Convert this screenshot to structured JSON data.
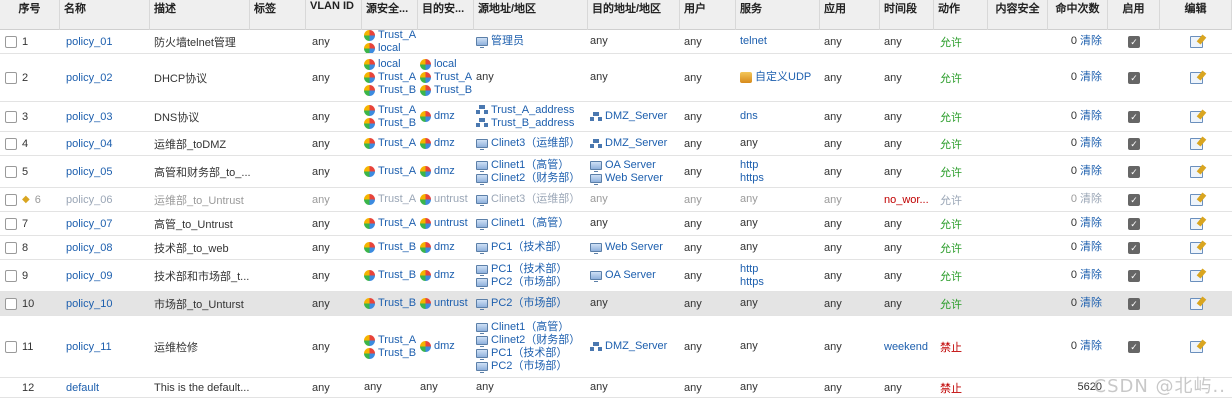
{
  "columns": [
    "序号",
    "名称",
    "描述",
    "标签",
    "VLAN ID",
    "源安全...",
    "目的安...",
    "源地址/地区",
    "目的地址/地区",
    "用户",
    "服务",
    "应用",
    "时间段",
    "动作",
    "内容安全",
    "命中次数",
    "启用",
    "编辑"
  ],
  "rows": [
    {
      "seq": "1",
      "name": "policy_01",
      "desc": "防火墙telnet管理",
      "vlan": "any",
      "src_zone": [
        {
          "t": "Trust_A",
          "z": 1
        },
        {
          "t": "local",
          "z": 1
        }
      ],
      "dst_zone": [],
      "src_addr": [
        {
          "t": "管理员",
          "i": "mon"
        }
      ],
      "dst_addr": [
        {
          "t": "any"
        }
      ],
      "user": "any",
      "service": [
        {
          "t": "telnet",
          "l": 1
        }
      ],
      "app": "any",
      "time": "any",
      "action": "允许",
      "hits": "0",
      "clear": "清除"
    },
    {
      "seq": "2",
      "name": "policy_02",
      "desc": "DHCP协议",
      "vlan": "any",
      "src_zone": [
        {
          "t": "local",
          "z": 1
        },
        {
          "t": "Trust_A",
          "z": 1
        },
        {
          "t": "Trust_B",
          "z": 1
        }
      ],
      "dst_zone": [
        {
          "t": "local",
          "z": 1
        },
        {
          "t": "Trust_A",
          "z": 1
        },
        {
          "t": "Trust_B",
          "z": 1
        }
      ],
      "src_addr": [
        {
          "t": "any"
        }
      ],
      "dst_addr": [
        {
          "t": "any"
        }
      ],
      "user": "any",
      "service": [
        {
          "t": "自定义UDP",
          "i": "udp"
        }
      ],
      "app": "any",
      "time": "any",
      "action": "允许",
      "hits": "0",
      "clear": "清除"
    },
    {
      "seq": "3",
      "name": "policy_03",
      "desc": "DNS协议",
      "vlan": "any",
      "src_zone": [
        {
          "t": "Trust_A",
          "z": 1
        },
        {
          "t": "Trust_B",
          "z": 1
        }
      ],
      "dst_zone": [
        {
          "t": "dmz",
          "z": 1
        }
      ],
      "src_addr": [
        {
          "t": "Trust_A_address",
          "i": "srv"
        },
        {
          "t": "Trust_B_address",
          "i": "srv"
        }
      ],
      "dst_addr": [
        {
          "t": "DMZ_Server",
          "i": "srv"
        }
      ],
      "user": "any",
      "service": [
        {
          "t": "dns",
          "l": 1
        }
      ],
      "app": "any",
      "time": "any",
      "action": "允许",
      "hits": "0",
      "clear": "清除"
    },
    {
      "seq": "4",
      "name": "policy_04",
      "desc": "运维部_toDMZ",
      "vlan": "any",
      "src_zone": [
        {
          "t": "Trust_A",
          "z": 1
        }
      ],
      "dst_zone": [
        {
          "t": "dmz",
          "z": 1
        }
      ],
      "src_addr": [
        {
          "t": "Clinet3（运维部）",
          "i": "mon"
        }
      ],
      "dst_addr": [
        {
          "t": "DMZ_Server",
          "i": "srv"
        }
      ],
      "user": "any",
      "service": [
        {
          "t": "any"
        }
      ],
      "app": "any",
      "time": "any",
      "action": "允许",
      "hits": "0",
      "clear": "清除"
    },
    {
      "seq": "5",
      "name": "policy_05",
      "desc": "高管和财务部_to_...",
      "vlan": "any",
      "src_zone": [
        {
          "t": "Trust_A",
          "z": 1
        }
      ],
      "dst_zone": [
        {
          "t": "dmz",
          "z": 1
        }
      ],
      "src_addr": [
        {
          "t": "Clinet1（高管）",
          "i": "mon"
        },
        {
          "t": "Clinet2（财务部）",
          "i": "mon"
        }
      ],
      "dst_addr": [
        {
          "t": "OA Server",
          "i": "mon"
        },
        {
          "t": "Web Server",
          "i": "mon"
        }
      ],
      "user": "any",
      "service": [
        {
          "t": "http",
          "l": 1
        },
        {
          "t": "https",
          "l": 1
        }
      ],
      "app": "any",
      "time": "any",
      "action": "允许",
      "hits": "0",
      "clear": "清除"
    },
    {
      "seq": "6",
      "name": "policy_06",
      "desc": "运维部_to_Untrust",
      "vlan": "any",
      "src_zone": [
        {
          "t": "Trust_A",
          "z": 1
        }
      ],
      "dst_zone": [
        {
          "t": "untrust",
          "z": 1
        }
      ],
      "src_addr": [
        {
          "t": "Clinet3（运维部）",
          "i": "mon"
        }
      ],
      "dst_addr": [
        {
          "t": "any"
        }
      ],
      "user": "any",
      "service": [
        {
          "t": "any"
        }
      ],
      "app": "any",
      "time": "no_wor...",
      "action": "允许",
      "hits": "0",
      "clear": "清除",
      "disabled": true
    },
    {
      "seq": "7",
      "name": "policy_07",
      "desc": "高管_to_Untrust",
      "vlan": "any",
      "src_zone": [
        {
          "t": "Trust_A",
          "z": 1
        }
      ],
      "dst_zone": [
        {
          "t": "untrust",
          "z": 1
        }
      ],
      "src_addr": [
        {
          "t": "Clinet1（高管）",
          "i": "mon"
        }
      ],
      "dst_addr": [
        {
          "t": "any"
        }
      ],
      "user": "any",
      "service": [
        {
          "t": "any"
        }
      ],
      "app": "any",
      "time": "any",
      "action": "允许",
      "hits": "0",
      "clear": "清除"
    },
    {
      "seq": "8",
      "name": "policy_08",
      "desc": "技术部_to_web",
      "vlan": "any",
      "src_zone": [
        {
          "t": "Trust_B",
          "z": 1
        }
      ],
      "dst_zone": [
        {
          "t": "dmz",
          "z": 1
        }
      ],
      "src_addr": [
        {
          "t": "PC1（技术部）",
          "i": "mon"
        }
      ],
      "dst_addr": [
        {
          "t": "Web Server",
          "i": "mon"
        }
      ],
      "user": "any",
      "service": [
        {
          "t": "any"
        }
      ],
      "app": "any",
      "time": "any",
      "action": "允许",
      "hits": "0",
      "clear": "清除"
    },
    {
      "seq": "9",
      "name": "policy_09",
      "desc": "技术部和市场部_t...",
      "vlan": "any",
      "src_zone": [
        {
          "t": "Trust_B",
          "z": 1
        }
      ],
      "dst_zone": [
        {
          "t": "dmz",
          "z": 1
        }
      ],
      "src_addr": [
        {
          "t": "PC1（技术部）",
          "i": "mon"
        },
        {
          "t": "PC2（市场部）",
          "i": "mon"
        }
      ],
      "dst_addr": [
        {
          "t": "OA Server",
          "i": "mon"
        }
      ],
      "user": "any",
      "service": [
        {
          "t": "http",
          "l": 1
        },
        {
          "t": "https",
          "l": 1
        }
      ],
      "app": "any",
      "time": "any",
      "action": "允许",
      "hits": "0",
      "clear": "清除"
    },
    {
      "seq": "10",
      "name": "policy_10",
      "desc": "市场部_to_Unturst",
      "vlan": "any",
      "src_zone": [
        {
          "t": "Trust_B",
          "z": 1
        }
      ],
      "dst_zone": [
        {
          "t": "untrust",
          "z": 1
        }
      ],
      "src_addr": [
        {
          "t": "PC2（市场部）",
          "i": "mon"
        }
      ],
      "dst_addr": [
        {
          "t": "any"
        }
      ],
      "user": "any",
      "service": [
        {
          "t": "any"
        }
      ],
      "app": "any",
      "time": "any",
      "action": "允许",
      "hits": "0",
      "clear": "清除",
      "selected": true
    },
    {
      "seq": "11",
      "name": "policy_11",
      "desc": "运维检修",
      "vlan": "any",
      "src_zone": [
        {
          "t": "Trust_A",
          "z": 1
        },
        {
          "t": "Trust_B",
          "z": 1
        }
      ],
      "dst_zone": [
        {
          "t": "dmz",
          "z": 1
        }
      ],
      "src_addr": [
        {
          "t": "Clinet1（高管）",
          "i": "mon"
        },
        {
          "t": "Clinet2（财务部）",
          "i": "mon"
        },
        {
          "t": "PC1（技术部）",
          "i": "mon"
        },
        {
          "t": "PC2（市场部）",
          "i": "mon"
        }
      ],
      "dst_addr": [
        {
          "t": "DMZ_Server",
          "i": "srv"
        }
      ],
      "user": "any",
      "service": [
        {
          "t": "any"
        }
      ],
      "app": "any",
      "time": "weekend",
      "action": "禁止",
      "hits": "0",
      "clear": "清除"
    },
    {
      "seq": "12",
      "name": "default",
      "desc": "This is the default...",
      "vlan": "any",
      "src_zone": [
        {
          "t": "any"
        }
      ],
      "dst_zone": [
        {
          "t": "any"
        }
      ],
      "src_addr": [
        {
          "t": "any"
        }
      ],
      "dst_addr": [
        {
          "t": "any"
        }
      ],
      "user": "any",
      "service": [
        {
          "t": "any"
        }
      ],
      "app": "any",
      "time": "any",
      "action": "禁止",
      "hits": "5620",
      "clear": "",
      "nocheck": true,
      "noedit": true
    }
  ],
  "watermark": "CSDN @北屿.."
}
